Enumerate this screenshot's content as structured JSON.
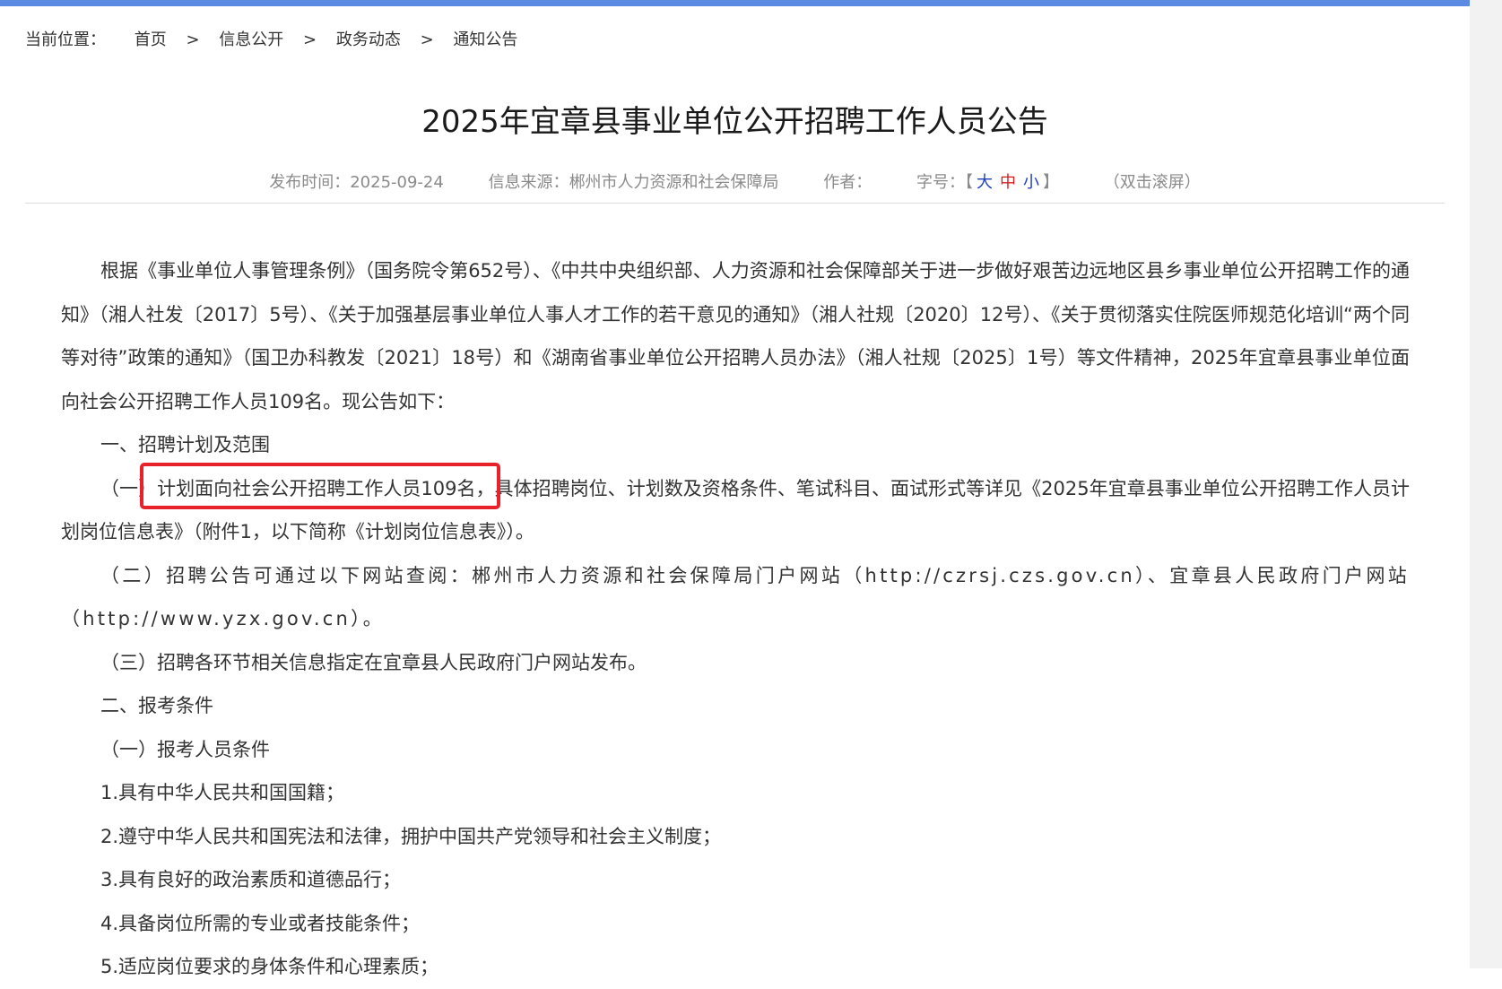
{
  "breadcrumb": {
    "prefix": "当前位置：",
    "separator": ">",
    "items": [
      "首页",
      "信息公开",
      "政务动态",
      "通知公告"
    ]
  },
  "title": "2025年宜章县事业单位公开招聘工作人员公告",
  "meta": {
    "publish_label": "发布时间：",
    "publish_date": "2025-09-24",
    "source_label": "信息来源：",
    "source_value": "郴州市人力资源和社会保障局",
    "author_label": "作者：",
    "font_size_label": "字号：",
    "bracket_open": "【",
    "font_big": "大",
    "font_mid": "中",
    "font_small": "小",
    "bracket_close": "】",
    "scroll_hint": "（双击滚屏）"
  },
  "article": {
    "intro": "根据《事业单位人事管理条例》（国务院令第652号）、《中共中央组织部、人力资源和社会保障部关于进一步做好艰苦边远地区县乡事业单位公开招聘工作的通知》（湘人社发〔2017〕5号）、《关于加强基层事业单位人事人才工作的若干意见的通知》（湘人社规〔2020〕12号）、《关于贯彻落实住院医师规范化培训“两个同等对待”政策的通知》（国卫办科教发〔2021〕18号）和《湖南省事业单位公开招聘人员办法》（湘人社规〔2025〕1号）等文件精神，2025年宜章县事业单位面向社会公开招聘工作人员109名。现公告如下：",
    "section1_heading": "一、招聘计划及范围",
    "item1_1_prefix": "（一）",
    "item1_1_highlight": "计划面向社会公开招聘工作人员109名，",
    "item1_1_rest": "具体招聘岗位、计划数及资格条件、笔试科目、面试形式等详见《2025年宜章县事业单位公开招聘工作人员计划岗位信息表》（附件1，以下简称《计划岗位信息表》）。",
    "item1_2": "（二）招聘公告可通过以下网站查阅：郴州市人力资源和社会保障局门户网站（http://czrsj.czs.gov.cn）、宜章县人民政府门户网站（http://www.yzx.gov.cn）。",
    "item1_3": "（三）招聘各环节相关信息指定在宜章县人民政府门户网站发布。",
    "section2_heading": "二、报考条件",
    "item2_1": "（一）报考人员条件",
    "cond1": "1.具有中华人民共和国国籍；",
    "cond2": "2.遵守中华人民共和国宪法和法律，拥护中国共产党领导和社会主义制度；",
    "cond3": "3.具有良好的政治素质和道德品行；",
    "cond4": "4.具备岗位所需的专业或者技能条件；",
    "cond5": "5.适应岗位要求的身体条件和心理素质；"
  },
  "colors": {
    "top_bar": "#5b8ae3",
    "highlight_border": "#e8222a",
    "font_big": "#1f3fbf",
    "font_mid": "#d42020",
    "font_small": "#1f3fbf"
  }
}
